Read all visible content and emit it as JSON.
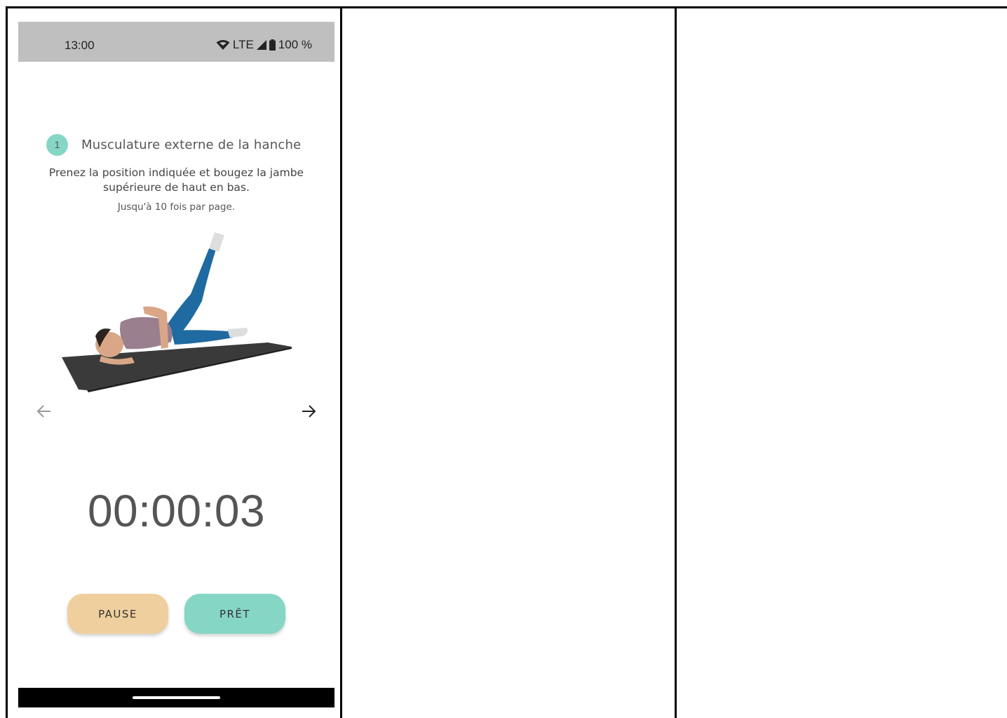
{
  "status_bar": {
    "time": "13:00",
    "network": "LTE",
    "battery": "100 %",
    "icons": [
      "wifi-icon",
      "signal-icon",
      "battery-icon"
    ]
  },
  "exercise": {
    "step_number": "1",
    "title": "Musculature externe de la hanche",
    "instruction": "Prenez la position indiquée et bougez la jambe supérieure de haut en bas.",
    "repeat_note": "Jusqu'à 10 fois par page."
  },
  "navigation": {
    "prev_icon": "arrow-left-icon",
    "next_icon": "arrow-right-icon"
  },
  "timer": {
    "value": "00:00:03"
  },
  "buttons": {
    "pause_label": "PAUSE",
    "ready_label": "PRÊT"
  },
  "colors": {
    "status_bar": "#bfbfbf",
    "accent_teal": "#86d6c6",
    "pause_beige": "#efcf9d",
    "nav_bar": "#000000"
  }
}
